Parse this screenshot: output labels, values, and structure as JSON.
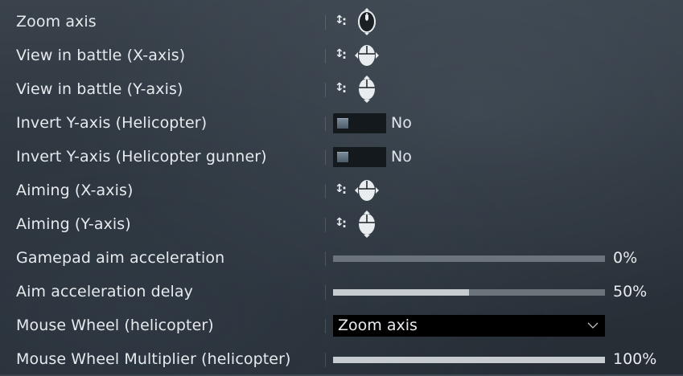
{
  "settings": [
    {
      "label": "Zoom axis",
      "type": "axis",
      "axis_symbol": "↕",
      "colon": ":",
      "icon": "mouse-wheel-icon"
    },
    {
      "label": "View in battle (X-axis)",
      "type": "axis",
      "axis_symbol": "↕",
      "colon": ":",
      "icon": "mouse-horizontal-icon"
    },
    {
      "label": "View in battle (Y-axis)",
      "type": "axis",
      "axis_symbol": "↕",
      "colon": ":",
      "icon": "mouse-vertical-icon"
    },
    {
      "label": "Invert Y-axis (Helicopter)",
      "type": "toggle",
      "state": "No"
    },
    {
      "label": "Invert Y-axis (Helicopter gunner)",
      "type": "toggle",
      "state": "No"
    },
    {
      "label": "Aiming (X-axis)",
      "type": "axis",
      "axis_symbol": "↕",
      "colon": ":",
      "icon": "mouse-horizontal-icon"
    },
    {
      "label": "Aiming (Y-axis)",
      "type": "axis",
      "axis_symbol": "↕",
      "colon": ":",
      "icon": "mouse-vertical-icon"
    },
    {
      "label": "Gamepad aim acceleration",
      "type": "slider",
      "value": 0,
      "value_label": "0%"
    },
    {
      "label": "Aim acceleration delay",
      "type": "slider",
      "value": 0.5,
      "value_label": "50%"
    },
    {
      "label": "Mouse Wheel (helicopter)",
      "type": "dropdown",
      "selected": "Zoom axis"
    },
    {
      "label": "Mouse Wheel Multiplier (helicopter)",
      "type": "slider",
      "value": 1.0,
      "value_label": "100%"
    }
  ]
}
